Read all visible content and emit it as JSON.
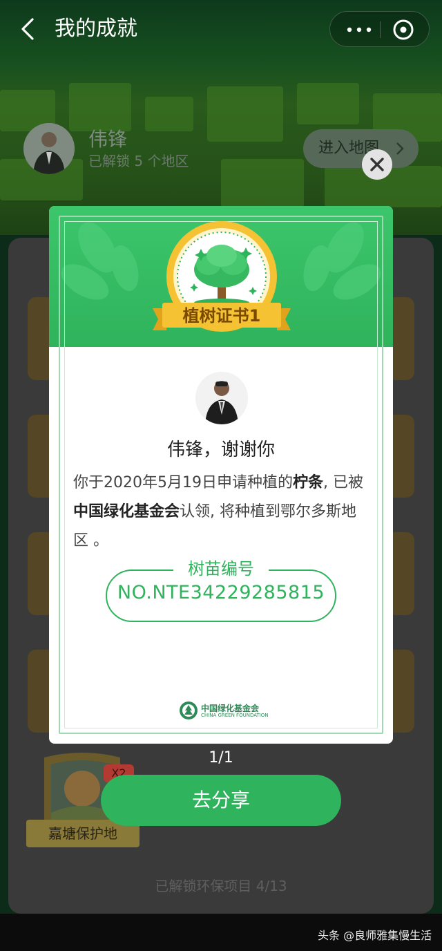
{
  "header": {
    "title": "我的成就",
    "more_icon": "more-dots-icon",
    "target_icon": "target-icon"
  },
  "profile": {
    "name": "伟锋",
    "unlocked": "已解锁 5 个地区",
    "enter_map": "进入地图"
  },
  "certificate": {
    "ribbon": "植树证书1",
    "thanks": "伟锋，谢谢你",
    "message_part1": "你于2020年5月19日申请种植的",
    "message_bold1": "柠条",
    "message_part2": ", 已被",
    "message_bold2": "中国绿化基金会",
    "message_part3": "认领, 将种植到鄂尔多斯地区 。",
    "seed_label": "树苗编号",
    "seed_number": "NO.NTE34229285815",
    "foundation_cn": "中国绿化基金会",
    "foundation_en": "CHINA GREEN FOUNDATION"
  },
  "pager": "1/1",
  "share_button": "去分享",
  "reserve": {
    "label": "嘉塘保护地",
    "multiplier": "X2"
  },
  "unlock_progress": "已解锁环保项目 4/13",
  "watermark": "头条 @良师雅集慢生活",
  "colors": {
    "accent": "#2fb35c",
    "ribbon": "#f4c233"
  }
}
